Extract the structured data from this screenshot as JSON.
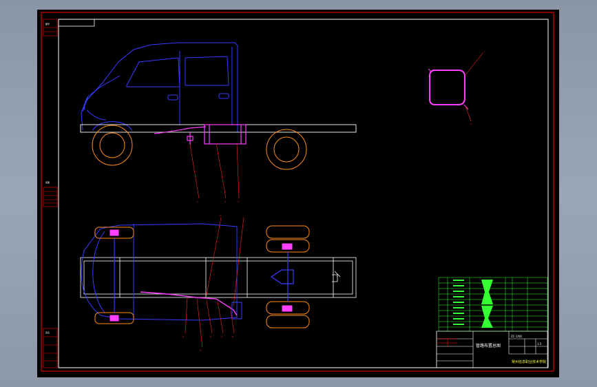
{
  "sheet": {
    "background": "#000000",
    "frame_color": "#ff0000",
    "border_color": "#ffffff"
  },
  "title_block": {
    "drawing_title": "管路布置总图",
    "company": "常州信息职业技术学院",
    "scale": "1:5",
    "drawing_number": "ZC-1/00"
  },
  "side_labels": {
    "top_left": "图号",
    "middle_left": "底图",
    "bottom_left": "签名"
  },
  "callouts": {
    "side_view": [
      "1",
      "2",
      "3"
    ],
    "plan_view": [
      "4",
      "5",
      "6",
      "7",
      "8",
      "9"
    ],
    "detail_view": [
      "1",
      "2"
    ]
  },
  "colors": {
    "cab": "#3a3aff",
    "frame": "#ffffff",
    "wheel": "#ff8c1a",
    "pipe": "#ff40ff",
    "leader": "#ff2020",
    "table": "#33ff33"
  },
  "icons": {
    "cab": "truck-cab-icon",
    "wheel": "wheel-icon",
    "tank": "fuel-tank-icon",
    "pipe_detail": "pipe-loop-icon"
  }
}
